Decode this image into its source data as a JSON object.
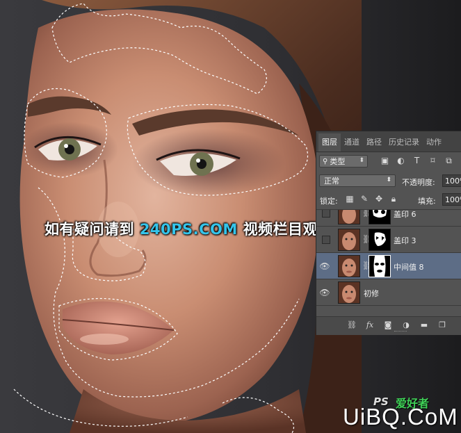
{
  "watermark": {
    "prefix": "如有疑问请到 ",
    "site": "240PS.COM",
    "suffix": " 视频栏目观看视频教程"
  },
  "logo": {
    "ps": "PS",
    "cn": "爱好者",
    "main": "UiBQ.CoM"
  },
  "layers_panel": {
    "tabs": [
      {
        "label": "图层",
        "active": true
      },
      {
        "label": "通道",
        "active": false
      },
      {
        "label": "路径",
        "active": false
      },
      {
        "label": "历史记录",
        "active": false
      },
      {
        "label": "动作",
        "active": false
      }
    ],
    "filter": {
      "kind_label": "类型",
      "icons": [
        "image-filter-icon",
        "adjustment-filter-icon",
        "type-filter-icon",
        "shape-filter-icon",
        "smart-object-filter-icon"
      ]
    },
    "blend_mode": "正常",
    "opacity_label": "不透明度:",
    "opacity_value": "100%",
    "lock_label": "锁定:",
    "fill_label": "填充:",
    "fill_value": "100%",
    "layers": [
      {
        "name": "盖印 6",
        "visible": false,
        "selected": false,
        "has_mask": true
      },
      {
        "name": "盖印 3",
        "visible": false,
        "selected": false,
        "has_mask": true
      },
      {
        "name": "中间值 8",
        "visible": true,
        "selected": true,
        "has_mask": true
      },
      {
        "name": "初修",
        "visible": true,
        "selected": false,
        "has_mask": false
      }
    ],
    "footer_icons": [
      "link-layers-icon",
      "fx-icon",
      "add-mask-icon",
      "adjustment-layer-icon",
      "new-group-icon",
      "new-layer-icon"
    ]
  },
  "colors": {
    "panel_bg": "#535353",
    "selected_layer": "#5d6d86",
    "watermark_accent": "#34c4ea",
    "logo_green": "#3fd157"
  }
}
